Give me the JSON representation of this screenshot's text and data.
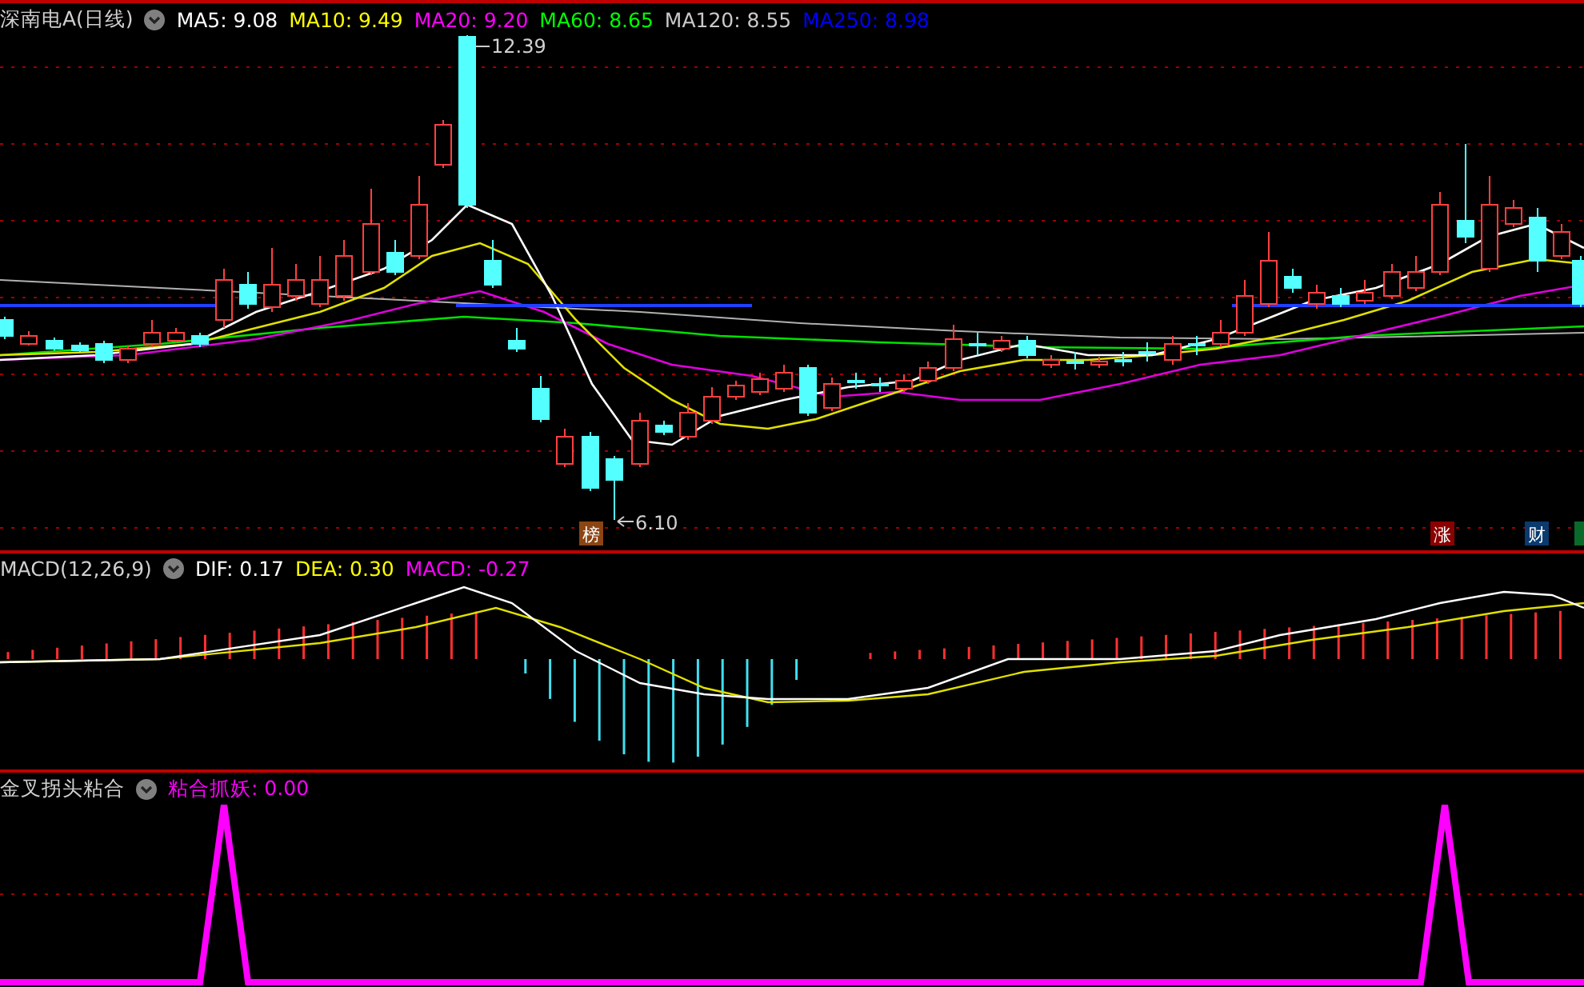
{
  "main_chart": {
    "title": "深南电A(日线)",
    "indicators": [
      {
        "text": "MA5: 9.08",
        "color": "#ffffff"
      },
      {
        "text": "MA10: 9.49",
        "color": "#ffff00"
      },
      {
        "text": "MA20: 9.20",
        "color": "#ff00ff"
      },
      {
        "text": "MA60: 8.65",
        "color": "#00ff00"
      },
      {
        "text": "MA120: 8.55",
        "color": "#c8c8c8"
      },
      {
        "text": "MA250: 8.98",
        "color": "#0000ff"
      }
    ],
    "high_label": "12.39",
    "low_label": "6.10",
    "markers": [
      {
        "text": "榜",
        "color": "#8b4513"
      },
      {
        "text": "涨",
        "color": "#8b0000"
      },
      {
        "text": "财",
        "color": "#0a3a6e"
      }
    ]
  },
  "macd_panel": {
    "title": "MACD(12,26,9)",
    "indicators": [
      {
        "text": "DIF: 0.17",
        "color": "#ffffff"
      },
      {
        "text": "DEA: 0.30",
        "color": "#ffff00"
      },
      {
        "text": "MACD: -0.27",
        "color": "#ff00ff"
      }
    ]
  },
  "signal_panel": {
    "title": "金叉拐头粘合",
    "indicators": [
      {
        "text": "粘合抓妖: 0.00",
        "color": "#ff00ff"
      }
    ]
  }
}
